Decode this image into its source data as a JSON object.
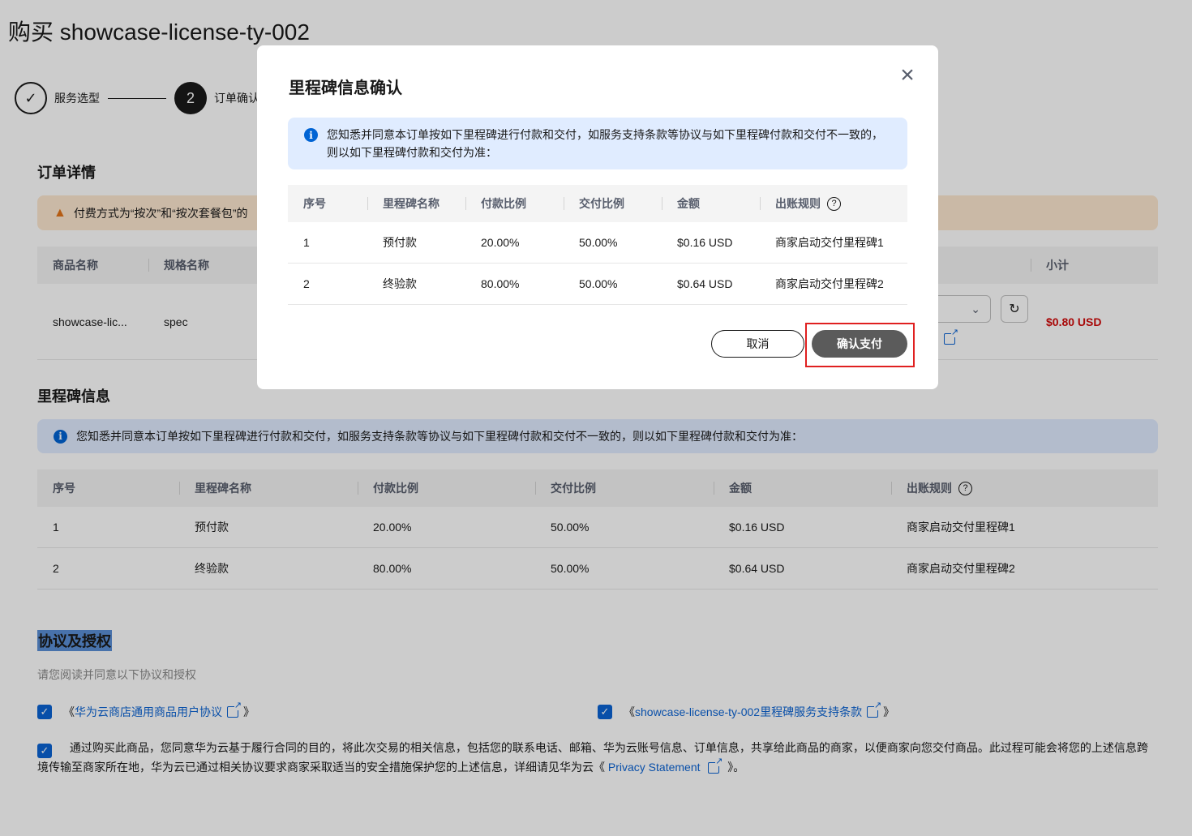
{
  "page": {
    "title": "购买 showcase-license-ty-002"
  },
  "steps": [
    {
      "label": "服务选型",
      "mark": "✓"
    },
    {
      "label": "订单确认",
      "mark": "2"
    }
  ],
  "order": {
    "title": "订单详情",
    "warning": "付费方式为“按次”和“按次套餐包”的",
    "columns": [
      "商品名称",
      "规格名称",
      "小计"
    ],
    "row": {
      "name": "showcase-lic...",
      "spec": "spec",
      "subtotal": "$0.80 USD"
    }
  },
  "milestone": {
    "title": "里程碑信息",
    "notice": "您知悉并同意本订单按如下里程碑进行付款和交付，如服务支持条款等协议与如下里程碑付款和交付不一致的，则以如下里程碑付款和交付为准：",
    "columns": [
      "序号",
      "里程碑名称",
      "付款比例",
      "交付比例",
      "金额",
      "出账规则"
    ],
    "rows": [
      [
        "1",
        "预付款",
        "20.00%",
        "50.00%",
        "$0.16 USD",
        "商家启动交付里程碑1"
      ],
      [
        "2",
        "终验款",
        "80.00%",
        "50.00%",
        "$0.64 USD",
        "商家启动交付里程碑2"
      ]
    ]
  },
  "agreement": {
    "title": "协议及授权",
    "subtitle": "请您阅读并同意以下协议和授权",
    "item1_prefix": "《",
    "item1_link": "华为云商店通用商品用户协议",
    "item1_suffix": "》",
    "item2_prefix": "《",
    "item2_link": "showcase-license-ty-002里程碑服务支持条款",
    "item2_suffix": "》",
    "privacy_text": "通过购买此商品，您同意华为云基于履行合同的目的，将此次交易的相关信息，包括您的联系电话、邮箱、华为云账号信息、订单信息，共享给此商品的商家，以便商家向您交付商品。此过程可能会将您的上述信息跨境传输至商家所在地，华为云已通过相关协议要求商家采取适当的安全措施保护您的上述信息，详细请见华为云《",
    "privacy_link": "Privacy Statement",
    "privacy_suffix": "》。"
  },
  "modal": {
    "title": "里程碑信息确认",
    "notice": "您知悉并同意本订单按如下里程碑进行付款和交付，如服务支持条款等协议与如下里程碑付款和交付不一致的，则以如下里程碑付款和交付为准：",
    "cancel_label": "取消",
    "confirm_label": "确认支付"
  },
  "icons": {
    "close": "close-icon",
    "info": "info-icon",
    "warning": "warning-icon",
    "help": "help-icon",
    "external": "external-link-icon",
    "refresh": "refresh-icon",
    "chevron": "chevron-down-icon"
  },
  "colors": {
    "accent": "#0b63d4",
    "price": "#d20a0a",
    "highlight": "#e02020",
    "confirm_button": "#5b5b5b"
  }
}
